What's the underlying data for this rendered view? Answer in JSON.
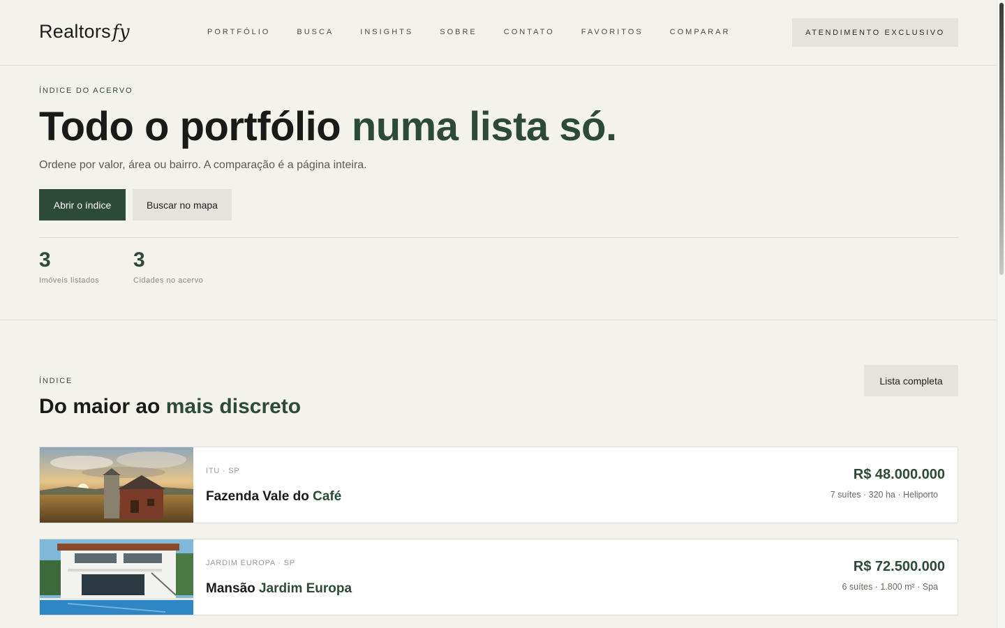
{
  "header": {
    "logo_main": "Realtors",
    "logo_accent": "fy",
    "nav": [
      "PORTFÓLIO",
      "BUSCA",
      "INSIGHTS",
      "SOBRE",
      "CONTATO",
      "FAVORITOS",
      "COMPARAR"
    ],
    "cta": "ATENDIMENTO EXCLUSIVO"
  },
  "hero": {
    "eyebrow": "ÍNDICE DO ACERVO",
    "title_main": "Todo o portfólio ",
    "title_accent": "numa lista só.",
    "subtitle": "Ordene por valor, área ou bairro. A comparação é a página inteira.",
    "primary_button": "Abrir o índice",
    "secondary_button": "Buscar no mapa",
    "stats": [
      {
        "value": "3",
        "label": "Imóveis listados"
      },
      {
        "value": "3",
        "label": "Cidades no acervo"
      }
    ]
  },
  "index_section": {
    "eyebrow": "ÍNDICE",
    "title_main": "Do maior ao ",
    "title_accent": "mais discreto",
    "list_button": "Lista completa"
  },
  "listings": [
    {
      "location": "ITU · SP",
      "name_main": "Fazenda Vale do ",
      "name_accent": "Café",
      "price": "R$ 48.000.000",
      "specs": "7 suítes · 320 ha · Heliporto",
      "image": "farm-sunset-photo"
    },
    {
      "location": "JARDIM EUROPA · SP",
      "name_main": "Mansão ",
      "name_accent": "Jardim Europa",
      "price": "R$ 72.500.000",
      "specs": "6 suítes · 1.800 m² · Spa",
      "image": "modern-mansion-pool-photo"
    }
  ],
  "colors": {
    "background": "#f3f2ed",
    "accent_green": "#2d4a38",
    "button_neutral": "#e4e3dd",
    "card": "#ffffff"
  }
}
